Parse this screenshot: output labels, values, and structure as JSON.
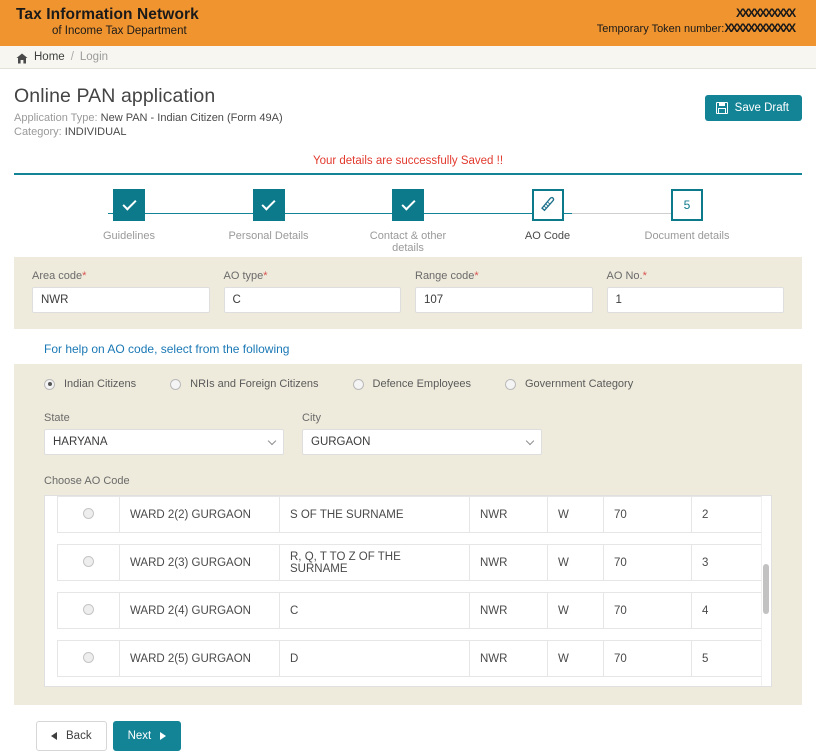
{
  "header": {
    "brand_line1": "Tax Information Network",
    "brand_line2": "of Income Tax Department",
    "redacted_id": "XXXXXXXXXX",
    "token_label": "Temporary Token number:",
    "token_value": "XXXXXXXXXXXX",
    "bg_color": "#f0942f"
  },
  "breadcrumb": {
    "home": "Home",
    "separator": "/",
    "current": "Login",
    "home_icon": "home-icon"
  },
  "page": {
    "title": "Online PAN application",
    "application_type_label": "Application Type:",
    "application_type_value": "New PAN - Indian Citizen (Form 49A)",
    "category_label": "Category:",
    "category_value": "INDIVIDUAL",
    "save_draft_label": "Save Draft",
    "save_icon": "floppy-disk-icon",
    "success_message": "Your details are successfully Saved !!",
    "success_color": "#e23a2e",
    "accent_color": "#138496"
  },
  "stepper": {
    "steps": [
      {
        "label": "Guidelines",
        "state": "done",
        "marker": "check-icon"
      },
      {
        "label": "Personal Details",
        "state": "done",
        "marker": "check-icon"
      },
      {
        "label": "Contact & other details",
        "state": "done",
        "marker": "check-icon"
      },
      {
        "label": "AO Code",
        "state": "active",
        "marker": "pencil-icon"
      },
      {
        "label": "Document details",
        "state": "todo",
        "marker": "5"
      }
    ]
  },
  "form": {
    "fields": [
      {
        "label": "Area code",
        "required": "*",
        "value": "NWR"
      },
      {
        "label": "AO type",
        "required": "*",
        "value": "C"
      },
      {
        "label": "Range code",
        "required": "*",
        "value": "107"
      },
      {
        "label": "AO No.",
        "required": "*",
        "value": "1"
      }
    ]
  },
  "help": {
    "text": "For help on AO code, select from the following",
    "color": "#1a78b5"
  },
  "categories": {
    "options": [
      {
        "label": "Indian Citizens",
        "selected": true
      },
      {
        "label": "NRIs and Foreign Citizens",
        "selected": false
      },
      {
        "label": "Defence Employees",
        "selected": false
      },
      {
        "label": "Government Category",
        "selected": false
      }
    ]
  },
  "selects": {
    "state": {
      "label": "State",
      "value": "HARYANA"
    },
    "city": {
      "label": "City",
      "value": "GURGAON"
    }
  },
  "ao_table": {
    "caption": "Choose AO Code",
    "rows": [
      {
        "ward": "WARD 2(2) GURGAON",
        "description": "S OF THE SURNAME",
        "area_code": "NWR",
        "ao_type": "W",
        "range_code": "70",
        "ao_no": "2",
        "selected": false
      },
      {
        "ward": "WARD 2(3) GURGAON",
        "description": "R, Q, T TO Z OF THE SURNAME",
        "area_code": "NWR",
        "ao_type": "W",
        "range_code": "70",
        "ao_no": "3",
        "selected": false
      },
      {
        "ward": "WARD 2(4) GURGAON",
        "description": "C",
        "area_code": "NWR",
        "ao_type": "W",
        "range_code": "70",
        "ao_no": "4",
        "selected": false
      },
      {
        "ward": "WARD 2(5) GURGAON",
        "description": "D",
        "area_code": "NWR",
        "ao_type": "W",
        "range_code": "70",
        "ao_no": "5",
        "selected": false
      }
    ]
  },
  "footer": {
    "back_label": "Back",
    "next_label": "Next",
    "back_icon": "arrow-left-icon",
    "next_icon": "arrow-right-icon"
  }
}
